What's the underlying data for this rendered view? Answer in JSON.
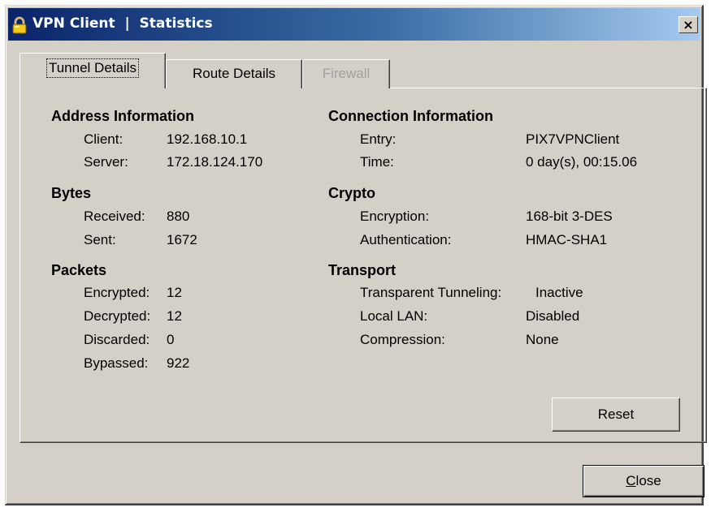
{
  "window": {
    "title": "VPN Client  |  Statistics",
    "close_glyph": "×"
  },
  "tabs": [
    {
      "label": "Tunnel Details",
      "active": true
    },
    {
      "label": "Route Details",
      "active": false
    },
    {
      "label": "Firewall",
      "active": false,
      "disabled": true
    }
  ],
  "address": {
    "title": "Address Information",
    "client_label": "Client:",
    "client_value": "192.168.10.1",
    "server_label": "Server:",
    "server_value": "172.18.124.170"
  },
  "bytes": {
    "title": "Bytes",
    "received_label": "Received:",
    "received_value": "880",
    "sent_label": "Sent:",
    "sent_value": "1672"
  },
  "packets": {
    "title": "Packets",
    "encrypted_label": "Encrypted:",
    "encrypted_value": "12",
    "decrypted_label": "Decrypted:",
    "decrypted_value": "12",
    "discarded_label": "Discarded:",
    "discarded_value": "0",
    "bypassed_label": "Bypassed:",
    "bypassed_value": "922"
  },
  "connection": {
    "title": "Connection Information",
    "entry_label": "Entry:",
    "entry_value": "PIX7VPNClient",
    "time_label": "Time:",
    "time_value": "0 day(s), 00:15.06"
  },
  "crypto": {
    "title": "Crypto",
    "encryption_label": "Encryption:",
    "encryption_value": "168-bit 3-DES",
    "authentication_label": "Authentication:",
    "authentication_value": "HMAC-SHA1"
  },
  "transport": {
    "title": "Transport",
    "tunneling_label": "Transparent Tunneling:",
    "tunneling_value": "Inactive",
    "local_lan_label": "Local LAN:",
    "local_lan_value": "Disabled",
    "compression_label": "Compression:",
    "compression_value": "None"
  },
  "buttons": {
    "reset_label": "Reset",
    "close_accel": "C",
    "close_rest": "lose"
  },
  "colors": {
    "titlebar_start": "#0a246a",
    "titlebar_end": "#a6caf0",
    "face": "#d4d0c8",
    "disabled_text": "#a0a0a0"
  }
}
